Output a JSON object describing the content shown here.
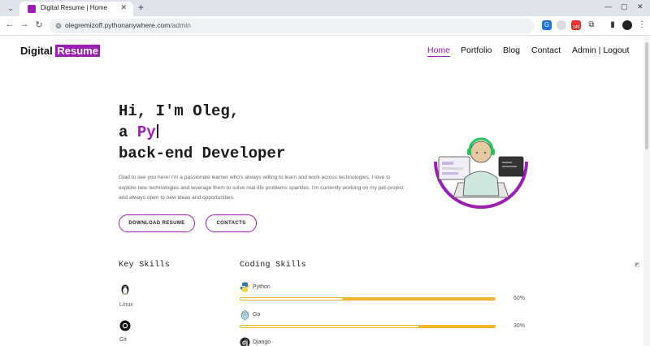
{
  "browser": {
    "tab_title": "Digital Resume  |  Home",
    "tab_close": "✕",
    "new_tab": "+",
    "url_host": "olegremizoff.pythonanywhere.com",
    "url_path": "/admin",
    "ext_badge": "145",
    "win_min": "—",
    "win_max": "▢",
    "win_close": "✕"
  },
  "brand": {
    "prefix": "Digital",
    "highlight": "Resume"
  },
  "nav": {
    "home": "Home",
    "portfolio": "Portfolio",
    "blog": "Blog",
    "contact": "Contact",
    "admin": "Admin | Logout"
  },
  "hero": {
    "line1": "Hi, I'm Oleg,",
    "line2_prefix": "a ",
    "line2_highlight": "Py",
    "line3": "back-end Developer",
    "intro": "Glad to see you here! I'm a passionate learner who's always willing to learn and work across technologies. I love to explore new technologies and leverage them to solve real-life problems sparkles. I'm currently working on my pet-project and always open to new ideas and opportunities."
  },
  "buttons": {
    "download": "DOWNLOAD RESUME",
    "contacts": "CONTACTS"
  },
  "key_skills": {
    "title": "Key Skills",
    "items": [
      {
        "label": "Linux",
        "icon": "linux-icon"
      },
      {
        "label": "Git",
        "icon": "github-icon"
      }
    ]
  },
  "coding_skills": {
    "title": "Coding Skills",
    "items": [
      {
        "label": "Python",
        "percent_label": "60%",
        "percent": 60,
        "icon": "python-icon"
      },
      {
        "label": "Go",
        "percent_label": "30%",
        "percent": 30,
        "icon": "go-gopher-icon"
      },
      {
        "label": "Django",
        "percent_label": "",
        "percent": 0,
        "icon": "django-icon"
      }
    ]
  },
  "colors": {
    "accent": "#9b1fb3",
    "bar": "#f0b52a",
    "bar_fill": "#f0b52a"
  }
}
